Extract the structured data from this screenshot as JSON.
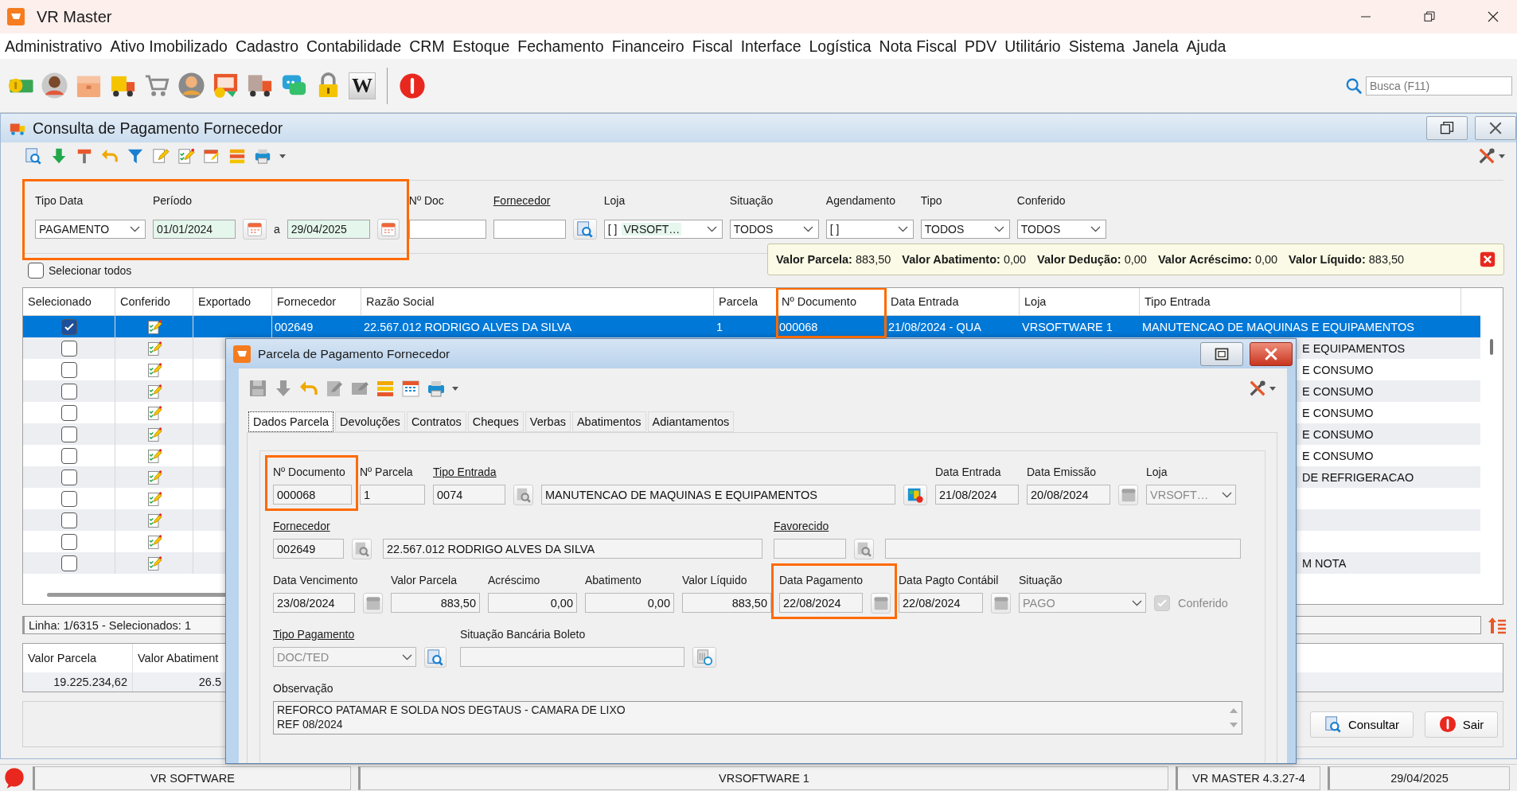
{
  "window": {
    "title": "VR Master"
  },
  "menu": [
    "Administrativo",
    "Ativo Imobilizado",
    "Cadastro",
    "Contabilidade",
    "CRM",
    "Estoque",
    "Fechamento",
    "Financeiro",
    "Fiscal",
    "Interface",
    "Logística",
    "Nota Fiscal",
    "PDV",
    "Utilitário",
    "Sistema",
    "Janela",
    "Ajuda"
  ],
  "toolbar": {
    "tile_letter": "W"
  },
  "search": {
    "placeholder": "Busca (F11)"
  },
  "consulta": {
    "title": "Consulta de Pagamento Fornecedor",
    "date_filter": {
      "highlighted": true,
      "fields": [
        {
          "kind": "select",
          "label": "Tipo Data",
          "value": "PAGAMENTO"
        },
        {
          "kind": "date_range",
          "label": "Período",
          "from": "01/01/2024",
          "separator": "a",
          "to": "29/04/2025"
        }
      ]
    },
    "filters": [
      {
        "kind": "text",
        "label": "Nº Doc"
      },
      {
        "kind": "lookup",
        "label": "Fornecedor",
        "link": true
      },
      {
        "kind": "multi_select",
        "label": "Loja",
        "mark": "[ ]",
        "value": "VRSOFT…"
      },
      {
        "kind": "select",
        "label": "Situação",
        "value": "TODOS"
      },
      {
        "kind": "multi_select",
        "label": "Agendamento",
        "mark": "[ ]"
      },
      {
        "kind": "select",
        "label": "Tipo",
        "value": "TODOS"
      },
      {
        "kind": "select",
        "label": "Conferido",
        "value": "TODOS"
      }
    ],
    "select_all": {
      "label": "Selecionar todos",
      "checked": false
    },
    "totals_tip": [
      "**Valor Parcela:** 883,50",
      "**Valor Abatimento:** 0,00",
      "**Valor Dedução:** 0,00",
      "**Valor Acréscimo:** 0,00",
      "**Valor Líquido:** 883,50"
    ],
    "table": {
      "columns": [
        {
          "label": "Selecionado"
        },
        {
          "label": "Conferido"
        },
        {
          "label": "Exportado"
        },
        {
          "label": "Fornecedor"
        },
        {
          "label": "Razão Social"
        },
        {
          "label": "Parcela"
        },
        {
          "label": "Nº Documento",
          "highlighted": true
        },
        {
          "label": "Data Entrada"
        },
        {
          "label": "Loja"
        },
        {
          "label": "Tipo Entrada"
        }
      ],
      "rows": [
        {
          "selected": true,
          "checked": true,
          "cells": [
            "002649",
            "22.567.012 RODRIGO ALVES DA SILVA",
            "1",
            "000068",
            "21/08/2024 - QUA",
            "VRSOFTWARE 1",
            "MANUTENCAO DE MAQUINAS E EQUIPAMENTOS"
          ]
        },
        {
          "selected": false,
          "checked": false,
          "tail": "E EQUIPAMENTOS"
        },
        {
          "selected": false,
          "checked": false,
          "tail": "E CONSUMO"
        },
        {
          "selected": false,
          "checked": false,
          "tail": "E CONSUMO"
        },
        {
          "selected": false,
          "checked": false,
          "tail": "E CONSUMO"
        },
        {
          "selected": false,
          "checked": false,
          "tail": "E CONSUMO"
        },
        {
          "selected": false,
          "checked": false,
          "tail": "E CONSUMO"
        },
        {
          "selected": false,
          "checked": false,
          "tail": "DE REFRIGERACAO"
        },
        {
          "selected": false,
          "checked": false
        },
        {
          "selected": false,
          "checked": false
        },
        {
          "selected": false,
          "checked": false
        },
        {
          "selected": false,
          "checked": false,
          "tail": "M NOTA"
        }
      ]
    },
    "line_info": "Linha: 1/6315 - Selecionados: 1",
    "totals": {
      "columns": [
        "Valor Parcela",
        "Valor Abatiment"
      ],
      "values": [
        "19.225.234,62",
        "26.5"
      ]
    },
    "buttons": [
      "Consultar",
      "Sair"
    ]
  },
  "dialog": {
    "title": "Parcela de Pagamento Fornecedor",
    "tabs": [
      {
        "label": "Dados Parcela",
        "selected": true
      },
      {
        "label": "Devoluções",
        "selected": false
      },
      {
        "label": "Contratos",
        "selected": false
      },
      {
        "label": "Cheques",
        "selected": false
      },
      {
        "label": "Verbas",
        "selected": false
      },
      {
        "label": "Abatimentos",
        "selected": false
      },
      {
        "label": "Adiantamentos",
        "selected": false
      }
    ],
    "lines": [
      {
        "fields": [
          {
            "kind": "text",
            "label": "Nº Documento",
            "value": "000068",
            "highlighted": true
          },
          {
            "kind": "text",
            "label": "Nº Parcela",
            "value": "1"
          },
          {
            "kind": "lookup",
            "label": "Tipo Entrada",
            "link": true,
            "value": "0074"
          },
          {
            "kind": "info",
            "value": "MANUTENCAO DE MAQUINAS E EQUIPAMENTOS"
          },
          {
            "kind": "text",
            "label": "Data Entrada",
            "value": "21/08/2024"
          },
          {
            "kind": "date",
            "label": "Data Emissão",
            "value": "20/08/2024"
          },
          {
            "kind": "select",
            "label": "Loja",
            "value": "VRSOFT…",
            "disabled": true
          }
        ]
      },
      {
        "fields": [
          {
            "kind": "lookup",
            "label": "Fornecedor",
            "link": true,
            "value": "002649"
          },
          {
            "kind": "text",
            "value": "22.567.012 RODRIGO ALVES DA SILVA"
          },
          {
            "kind": "lookup",
            "label": "Favorecido",
            "link": true
          },
          {
            "kind": "text"
          }
        ]
      },
      {
        "fields": [
          {
            "kind": "date",
            "label": "Data Vencimento",
            "value": "23/08/2024"
          },
          {
            "kind": "number",
            "label": "Valor Parcela",
            "value": "883,50"
          },
          {
            "kind": "number",
            "label": "Acréscimo",
            "value": "0,00"
          },
          {
            "kind": "number",
            "label": "Abatimento",
            "value": "0,00"
          },
          {
            "kind": "number",
            "label": "Valor Líquido",
            "value": "883,50"
          },
          {
            "kind": "date",
            "label": "Data Pagamento",
            "value": "22/08/2024",
            "highlighted": true
          },
          {
            "kind": "date",
            "label": "Data Pagto Contábil",
            "value": "22/08/2024"
          },
          {
            "kind": "select",
            "label": "Situação",
            "value": "PAGO",
            "disabled": true
          },
          {
            "kind": "check",
            "label": "Conferido",
            "checked": true,
            "disabled": true
          }
        ]
      },
      {
        "fields": [
          {
            "kind": "select_lookup",
            "label": "Tipo Pagamento",
            "link": true,
            "value": "DOC/TED",
            "disabled": true
          },
          {
            "kind": "boleto",
            "label": "Situação Bancária Boleto"
          }
        ]
      },
      {
        "fields": [
          {
            "kind": "memo",
            "label": "Observação",
            "lines": [
              "REFORCO PATAMAR E SOLDA NOS DEGTAUS - CAMARA DE LIXO",
              "REF 08/2024"
            ]
          }
        ]
      }
    ]
  },
  "status_bar": [
    "VR SOFTWARE",
    "VRSOFTWARE 1",
    "VR MASTER 4.3.27-4",
    "29/04/2025"
  ]
}
